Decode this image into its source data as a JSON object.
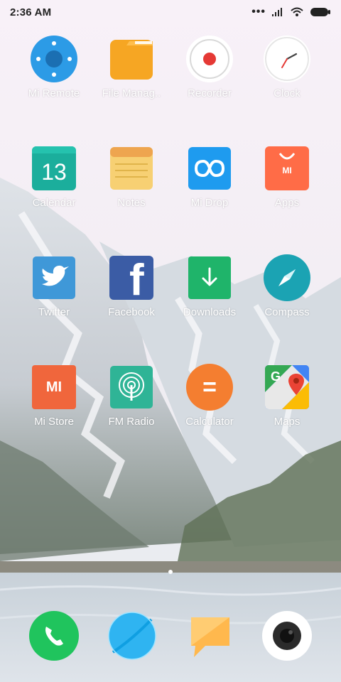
{
  "status": {
    "time": "2:36 AM",
    "icons": [
      "signal-dots-icon",
      "cellular-signal-icon",
      "wifi-icon",
      "battery-icon"
    ]
  },
  "apps": [
    {
      "label": "Mi Remote",
      "icon": "mi-remote-icon",
      "color": "#2c9be6"
    },
    {
      "label": "File Manag..",
      "icon": "file-manager-icon",
      "color": "#f6a623"
    },
    {
      "label": "Recorder",
      "icon": "recorder-icon",
      "color": "#e53935"
    },
    {
      "label": "Clock",
      "icon": "clock-icon",
      "color": "#ffffff"
    },
    {
      "label": "Calendar",
      "icon": "calendar-icon",
      "color": "#1bae9c",
      "number": "13"
    },
    {
      "label": "Notes",
      "icon": "notes-icon",
      "color": "#f7d073"
    },
    {
      "label": "Mi Drop",
      "icon": "mi-drop-icon",
      "color": "#1e9bef"
    },
    {
      "label": "Apps",
      "icon": "app-store-icon",
      "color": "#ff6c47",
      "text": "MI"
    },
    {
      "label": "Twitter",
      "icon": "twitter-icon",
      "color": "#3f98d8"
    },
    {
      "label": "Facebook",
      "icon": "facebook-icon",
      "color": "#3b5ca5",
      "text": "f"
    },
    {
      "label": "Downloads",
      "icon": "downloads-icon",
      "color": "#1fb46a"
    },
    {
      "label": "Compass",
      "icon": "compass-icon",
      "color": "#1ba3b3"
    },
    {
      "label": "Mi Store",
      "icon": "mi-store-icon",
      "color": "#f0663c",
      "text": "MI"
    },
    {
      "label": "FM Radio",
      "icon": "fm-radio-icon",
      "color": "#2fb496"
    },
    {
      "label": "Calculator",
      "icon": "calculator-icon",
      "color": "#f47e30",
      "text": "="
    },
    {
      "label": "Maps",
      "icon": "maps-icon",
      "color": "#34a853",
      "text": "G"
    }
  ],
  "dock": [
    {
      "icon": "phone-icon",
      "color": "#20c45d"
    },
    {
      "icon": "browser-icon",
      "color": "#2fb4f1"
    },
    {
      "icon": "messaging-icon",
      "color": "#ffb84d"
    },
    {
      "icon": "camera-icon",
      "color": "#2b2b2b"
    }
  ],
  "pager": {
    "current": 1,
    "total": 1
  }
}
